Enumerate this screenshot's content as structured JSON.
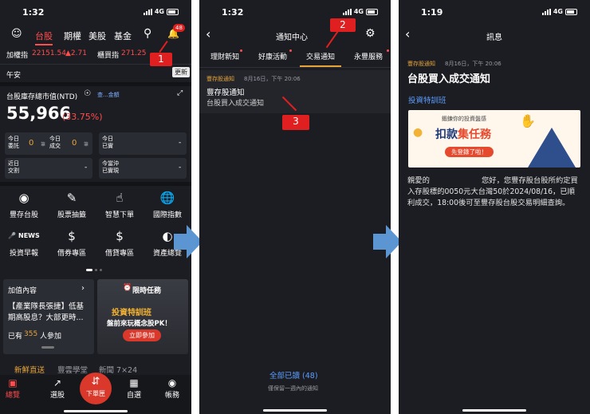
{
  "phone1": {
    "status": {
      "time": "1:32",
      "network": "4G"
    },
    "tabs": [
      "台股",
      "期權",
      "美股",
      "基金"
    ],
    "badge": "48",
    "ticker": {
      "name1": "加權指",
      "val1": "22151.54",
      "chg1": "▲2.71",
      "name2": "櫃買指",
      "val2": "271.25"
    },
    "update": "更新",
    "greeting": "午安",
    "market_value_label": "台股庫存總市值(NTD)",
    "hide_btn": "查...金額",
    "market_value": "55,966",
    "market_pct": "(33.75%)",
    "orders": {
      "today_entrust": "今日\n委託",
      "entrust_val": "0",
      "unit": "筆",
      "today_deal": "今日\n成交",
      "deal_val": "0",
      "today_real": "今日\n已實",
      "recent": "近日\n交割",
      "today_charge": "今當沖\n已實現",
      "dash": "-"
    },
    "grid": [
      "豐存台股",
      "股票抽籤",
      "智慧下單",
      "國際指數",
      "投資早報",
      "借券專區",
      "借貸專區",
      "資產總覽"
    ],
    "news_title": "加值內容",
    "news_text": "【產業隊長張捷】低基期高股息？大部更時...",
    "news_count_pre": "已有",
    "news_count": "355",
    "news_count_post": "人參加",
    "promo": {
      "title": "限時任務",
      "line1": "投資特訓班",
      "line2": "盤前來玩概念股PK！",
      "btn": "立即參加"
    },
    "bottom_tabs": [
      "新鮮直送",
      "豐雲學堂",
      "新聞 7×24"
    ],
    "nav": [
      "總覽",
      "選股",
      "下單匣",
      "自選",
      "帳務"
    ]
  },
  "phone2": {
    "status": {
      "time": "1:32",
      "network": "4G"
    },
    "title": "通知中心",
    "tabs": [
      "理財新知",
      "好康活動",
      "交易通知",
      "永豐服務"
    ],
    "item": {
      "source": "豐存股通知",
      "date": "8月16日，下午 20:06",
      "title": "豐存股通知",
      "body": "台股買入成交通知"
    },
    "read_all": "全部已讀 (48)",
    "note": "僅保留一週內的通知"
  },
  "phone3": {
    "status": {
      "time": "1:19",
      "network": "4G"
    },
    "title": "訊息",
    "source": "豐存股通知",
    "date": "8月16日，下午 20:06",
    "heading": "台股買入成交通知",
    "link": "投資特訓班",
    "banner": {
      "top": "鍛鍊你的投資盤感",
      "big1": "扣款",
      "big2": "集任務",
      "btn": "先登錄了啦！"
    },
    "body": "親愛的　　　　　　　您好，您豐存股台股所約定買入存股標的0050元大台灣50於2024/08/16，已順利成交，18:00後可至豐存股台股交易明細查詢。"
  },
  "callouts": [
    "1",
    "2",
    "3"
  ]
}
